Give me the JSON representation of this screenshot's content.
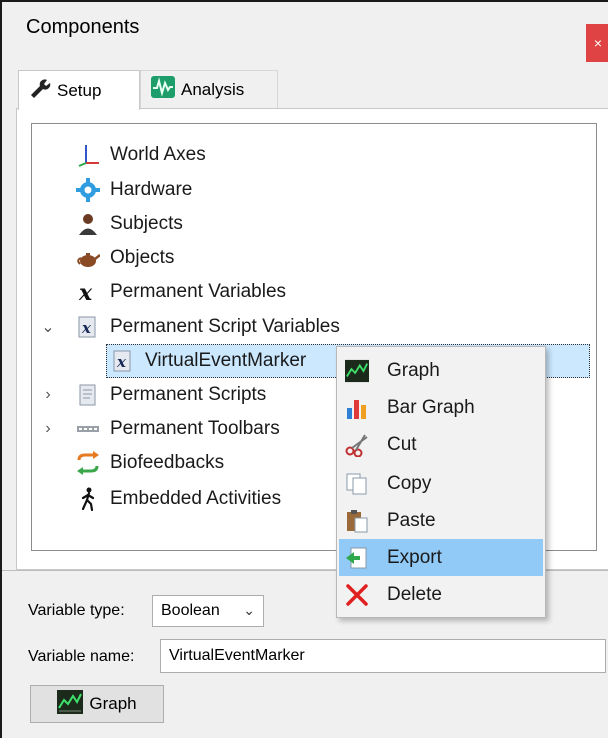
{
  "window": {
    "title": "Components",
    "close_glyph": "×"
  },
  "tabs": [
    {
      "label": "Setup",
      "icon": "wrench-icon",
      "active": true
    },
    {
      "label": "Analysis",
      "icon": "waveform-icon",
      "active": false
    }
  ],
  "tree": {
    "items": [
      {
        "label": "World Axes",
        "icon": "axes-icon"
      },
      {
        "label": "Hardware",
        "icon": "gear-icon"
      },
      {
        "label": "Subjects",
        "icon": "person-icon"
      },
      {
        "label": "Objects",
        "icon": "teapot-icon"
      },
      {
        "label": "Permanent Variables",
        "icon": "variable-x-icon"
      },
      {
        "label": "Permanent Script Variables",
        "icon": "script-variable-icon",
        "expanded": true
      },
      {
        "label": "VirtualEventMarker",
        "icon": "script-variable-icon",
        "selected": true
      },
      {
        "label": "Permanent Scripts",
        "icon": "script-icon",
        "collapsed": true
      },
      {
        "label": "Permanent Toolbars",
        "icon": "toolbar-icon",
        "collapsed": true
      },
      {
        "label": "Biofeedbacks",
        "icon": "feedback-loop-icon"
      },
      {
        "label": "Embedded Activities",
        "icon": "walking-person-icon"
      }
    ]
  },
  "context_menu": {
    "items": [
      {
        "label": "Graph",
        "icon": "line-graph-icon"
      },
      {
        "label": "Bar Graph",
        "icon": "bar-graph-icon"
      },
      {
        "label": "Cut",
        "icon": "scissors-icon"
      },
      {
        "label": "Copy",
        "icon": "copy-icon"
      },
      {
        "label": "Paste",
        "icon": "paste-icon"
      },
      {
        "label": "Export",
        "icon": "export-icon",
        "highlighted": true
      },
      {
        "label": "Delete",
        "icon": "delete-x-icon"
      }
    ]
  },
  "properties": {
    "type_label": "Variable type:",
    "type_value": "Boolean",
    "name_label": "Variable name:",
    "name_value": "VirtualEventMarker",
    "graph_button": "Graph"
  },
  "colors": {
    "selection": "#cce8ff",
    "menu_highlight": "#91c9f7",
    "close_button": "#e04343"
  }
}
